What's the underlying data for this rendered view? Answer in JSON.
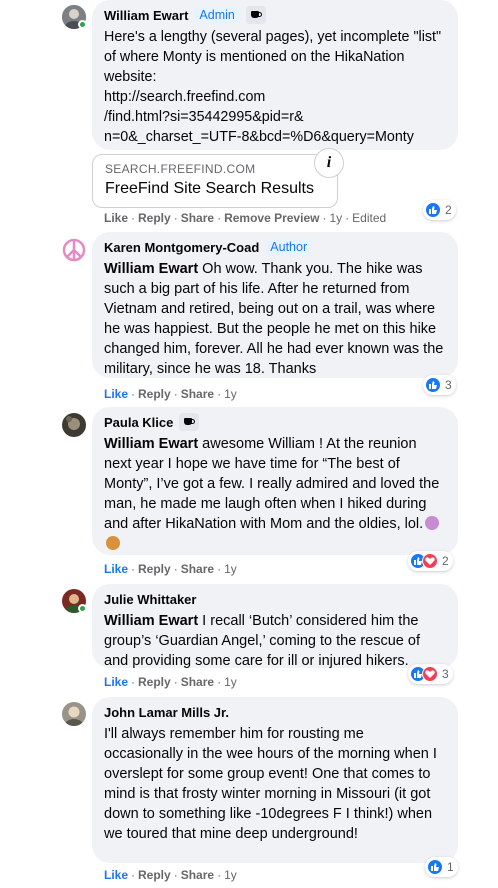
{
  "comments": [
    {
      "author": "William Ewart",
      "badge": "Admin",
      "text": "Here's a lengthy (several pages), yet incomplete \"list\" of where Monty is mentioned on the HikaNation website:\nhttp://search.freefind.com\n/find.html?si=35442995&pid=r&\nn=0&_charset_=UTF-8&bcd=%D6&query=Monty",
      "preview": {
        "domain": "SEARCH.FREEFIND.COM",
        "title": "FreeFind Site Search Results",
        "info": "i"
      },
      "actions": {
        "like": "Like",
        "reply": "Reply",
        "share": "Share",
        "remove_preview": "Remove Preview",
        "time": "1y",
        "edited": "Edited"
      },
      "reactions": {
        "count": "2"
      }
    },
    {
      "author": "Karen Montgomery-Coad",
      "badge": "Author",
      "mention": "William Ewart",
      "text": " Oh wow. Thank you. The hike was such a big part of his life. After he returned from Vietnam and retired, being out on a trail, was where he was happiest. But the people he met on this hike changed him, forever. All he had ever known was the military, since he was 18. Thanks",
      "actions": {
        "like": "Like",
        "reply": "Reply",
        "share": "Share",
        "time": "1y"
      },
      "reactions": {
        "count": "3"
      }
    },
    {
      "author": "Paula Klice",
      "mention": "William Ewart",
      "text": " awesome William ! At the reunion next year I hope we have time for “The best of Monty”, I’ve got a few. I really admired and loved the man, he made me laugh often when I hiked during and after HikaNation with Mom and the oldies, lol.",
      "actions": {
        "like": "Like",
        "reply": "Reply",
        "share": "Share",
        "time": "1y"
      },
      "reactions": {
        "count": "2"
      }
    },
    {
      "author": "Julie Whittaker",
      "mention": "William Ewart",
      "text": " I recall ‘Butch’ considered him the group’s ‘Guardian Angel,’ coming to the rescue of and providing some care for ill or injured hikers.",
      "actions": {
        "like": "Like",
        "reply": "Reply",
        "share": "Share",
        "time": "1y"
      },
      "reactions": {
        "count": "3"
      }
    },
    {
      "author": "John Lamar Mills Jr.",
      "text": "I'll always remember him for rousting me occasionally in the wee hours of the morning when I overslept for some group event! One that comes to mind is that frosty winter morning in Missouri (it got down to something like -10degrees F I think!) when we toured that mine deep underground!",
      "actions": {
        "like": "Like",
        "reply": "Reply",
        "share": "Share",
        "time": "1y"
      },
      "reactions": {
        "count": "1"
      }
    }
  ],
  "colors": {
    "accent": "#1877f2",
    "bubble": "#f0f2f5",
    "muted": "#65676b",
    "love": "#f33e58",
    "online": "#31a24c"
  },
  "icons": [
    "coffee-cup-icon",
    "info-icon",
    "like-reaction-icon",
    "love-reaction-icon",
    "peace-sign-icon",
    "emoji-icon"
  ]
}
